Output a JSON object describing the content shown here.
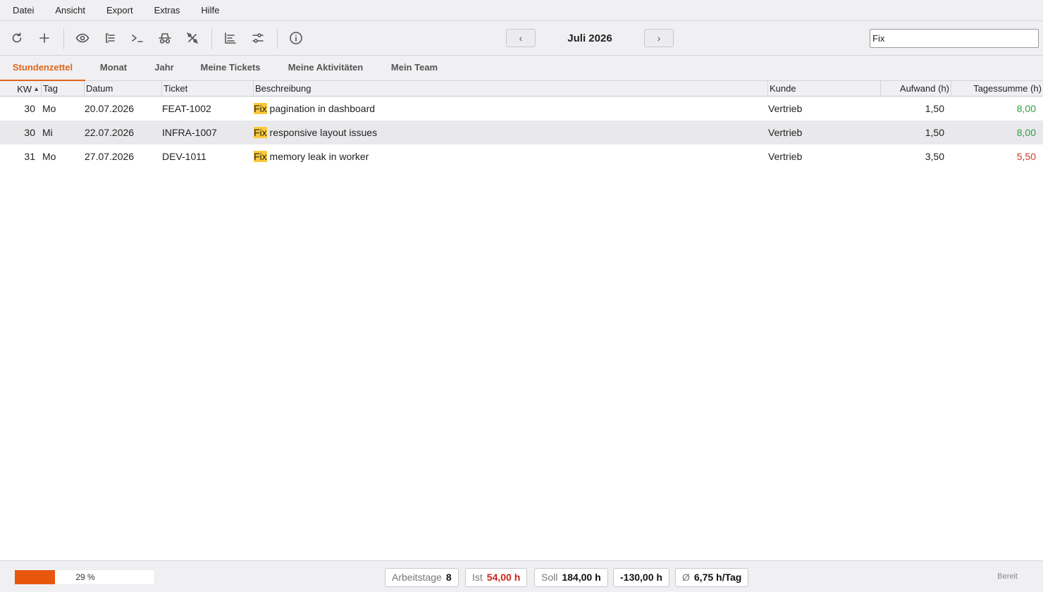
{
  "menu": [
    "Datei",
    "Ansicht",
    "Export",
    "Extras",
    "Hilfe"
  ],
  "toolbar": {
    "icons": [
      "refresh-icon",
      "plus-icon",
      "eye-icon",
      "list-icon",
      "terminal-icon",
      "incognito-icon",
      "percent-off-icon",
      "align-left-icon",
      "sliders-icon",
      "info-icon"
    ],
    "prev_label": "‹",
    "next_label": "›",
    "month": "Juli 2026"
  },
  "search": {
    "value": "Fix"
  },
  "tabs": [
    "Stundenzettel",
    "Monat",
    "Jahr",
    "Meine Tickets",
    "Meine Aktivitäten",
    "Mein Team"
  ],
  "active_tab": "Stundenzettel",
  "table": {
    "columns": [
      "KW",
      "Tag",
      "Datum",
      "Ticket",
      "Beschreibung",
      "Kunde",
      "Aufwand (h)",
      "Tagessumme (h)"
    ],
    "sort_indicator": "▲",
    "rows": [
      {
        "kw": "30",
        "tag": "Mo",
        "datum": "20.07.2026",
        "ticket": "FEAT-1002",
        "match": "Fix",
        "desc": " pagination in dashboard",
        "kunde": "Vertrieb",
        "aufwand": "1,50",
        "summe": "8,00",
        "summe_color": "green"
      },
      {
        "kw": "30",
        "tag": "Mi",
        "datum": "22.07.2026",
        "ticket": "INFRA-1007",
        "match": "Fix",
        "desc": " responsive layout issues",
        "kunde": "Vertrieb",
        "aufwand": "1,50",
        "summe": "8,00",
        "summe_color": "green"
      },
      {
        "kw": "31",
        "tag": "Mo",
        "datum": "27.07.2026",
        "ticket": "DEV-1011",
        "match": "Fix",
        "desc": " memory leak in worker",
        "kunde": "Vertrieb",
        "aufwand": "3,50",
        "summe": "5,50",
        "summe_color": "red"
      }
    ]
  },
  "status": {
    "progress_percent": 29,
    "progress_label": "29 %",
    "arbeitstage_label": "Arbeitstage",
    "arbeitstage_value": "8",
    "ist_label": "Ist",
    "ist_value": "54,00 h",
    "soll_label": "Soll",
    "soll_value": "184,00 h",
    "diff_value": "-130,00 h",
    "avg_label": "Ø",
    "avg_value": "6,75 h/Tag",
    "state": "Bereit"
  },
  "colors": {
    "accent": "#e0661a",
    "progress": "#e8560e",
    "highlight": "#fcc93a",
    "positive": "#2e9e3e",
    "negative": "#d23a2a"
  }
}
